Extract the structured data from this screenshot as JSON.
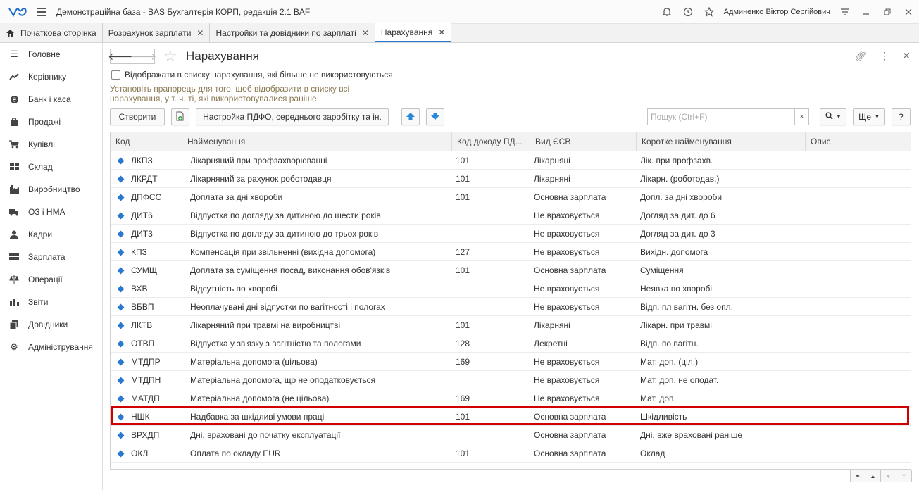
{
  "window": {
    "title": "Демонстраційна база - BAS Бухгалтерія КОРП, редакція 2.1 BAF",
    "user": "Админенко Віктор Сергійович"
  },
  "tabs": [
    {
      "label": "Початкова сторінка"
    },
    {
      "label": "Розрахунок зарплати"
    },
    {
      "label": "Настройки та довідники по зарплаті"
    },
    {
      "label": "Нарахування"
    }
  ],
  "sidebar": {
    "items": [
      {
        "label": "Головне",
        "icon": "menu-icon"
      },
      {
        "label": "Керівнику",
        "icon": "trend-icon"
      },
      {
        "label": "Банк і каса",
        "icon": "coin-icon"
      },
      {
        "label": "Продажі",
        "icon": "bag-icon"
      },
      {
        "label": "Купівлі",
        "icon": "cart-icon"
      },
      {
        "label": "Склад",
        "icon": "warehouse-icon"
      },
      {
        "label": "Виробництво",
        "icon": "factory-icon"
      },
      {
        "label": "ОЗ і НМА",
        "icon": "truck-icon"
      },
      {
        "label": "Кадри",
        "icon": "person-icon"
      },
      {
        "label": "Зарплата",
        "icon": "wallet-icon"
      },
      {
        "label": "Операції",
        "icon": "scales-icon"
      },
      {
        "label": "Звіти",
        "icon": "barchart-icon"
      },
      {
        "label": "Довідники",
        "icon": "books-icon"
      },
      {
        "label": "Адміністрування",
        "icon": "gear-icon"
      }
    ]
  },
  "form": {
    "title": "Нарахування",
    "checkbox_label": "Відображати в списку нарахування, які більше не використовуються",
    "hint": "Установіть прапорець для того, щоб відобразити в списку всі нарахування, у т. ч. ті, які використовувалися раніше.",
    "create_label": "Створити",
    "settings_label": "Настройка ПДФО, середнього заробітку та ін.",
    "search_placeholder": "Пошук (Ctrl+F)",
    "search_clear": "×",
    "more_label": "Ще",
    "help_label": "?"
  },
  "table": {
    "columns": [
      "Код",
      "Найменування",
      "Код доходу ПД...",
      "Вид ЄСВ",
      "Коротке найменування",
      "Опис"
    ],
    "rows": [
      [
        "ЛКПЗ",
        "Лікарняний при профзахворюванні",
        "101",
        "Лікарняні",
        "Лік. при профзахв.",
        ""
      ],
      [
        "ЛКРДТ",
        "Лікарняний за рахунок роботодавця",
        "101",
        "Лікарняні",
        "Лікарн. (роботодав.)",
        ""
      ],
      [
        "ДПФСС",
        "Доплата за дні хвороби",
        "101",
        "Основна зарплата",
        "Допл. за дні хвороби",
        ""
      ],
      [
        "ДИТ6",
        "Відпустка по догляду за дитиною до шести років",
        "",
        "Не враховується",
        "Догляд за дит. до 6",
        ""
      ],
      [
        "ДИТ3",
        "Відпустка по догляду за дитиною до трьох років",
        "",
        "Не враховується",
        "Догляд за дит. до 3",
        ""
      ],
      [
        "КПЗ",
        "Компенсація при звільненні (вихідна допомога)",
        "127",
        "Не враховується",
        "Вихідн. допомога",
        ""
      ],
      [
        "СУМЩ",
        "Доплата за суміщення посад, виконання обов'язків",
        "101",
        "Основна зарплата",
        "Суміщення",
        ""
      ],
      [
        "ВХВ",
        "Відсутність по хворобі",
        "",
        "Не враховується",
        "Неявка по хворобі",
        ""
      ],
      [
        "ВБВП",
        "Неоплачувані дні відпустки по вагітності і пологах",
        "",
        "Не враховується",
        "Відп. пл вагітн. без опл.",
        ""
      ],
      [
        "ЛКТВ",
        "Лікарняний при травмі на виробництві",
        "101",
        "Лікарняні",
        "Лікарн. при травмі",
        ""
      ],
      [
        "ОТВП",
        "Відпустка у зв'язку з вагітністю та пологами",
        "128",
        "Декретні",
        "Відп. по вагітн.",
        ""
      ],
      [
        "МТДПР",
        "Матеріальна допомога (цільова)",
        "169",
        "Не враховується",
        "Мат. доп. (ціл.)",
        ""
      ],
      [
        "МТДПН",
        "Матеріальна допомога, що не оподатковується",
        "",
        "Не враховується",
        "Мат. доп. не оподат.",
        ""
      ],
      [
        "МАТДП",
        "Матеріальна допомога (не цільова)",
        "169",
        "Не враховується",
        "Мат. доп.",
        ""
      ],
      [
        "НШК",
        "Надбавка за шкідливі умови праці",
        "101",
        "Основна зарплата",
        "Шкідливість",
        ""
      ],
      [
        "ВРХДП",
        "Дні, враховані до початку експлуатації",
        "",
        "Основна зарплата",
        "Дні, вже враховані раніше",
        ""
      ],
      [
        "ОКЛ",
        "Оплата по окладу EUR",
        "101",
        "Основна зарплата",
        "Оклад",
        ""
      ]
    ],
    "highlighted_row": "НШК"
  },
  "colors": {
    "accent": "#2a7bd0",
    "highlight": "#d00000",
    "hint": "#8a7a52"
  }
}
